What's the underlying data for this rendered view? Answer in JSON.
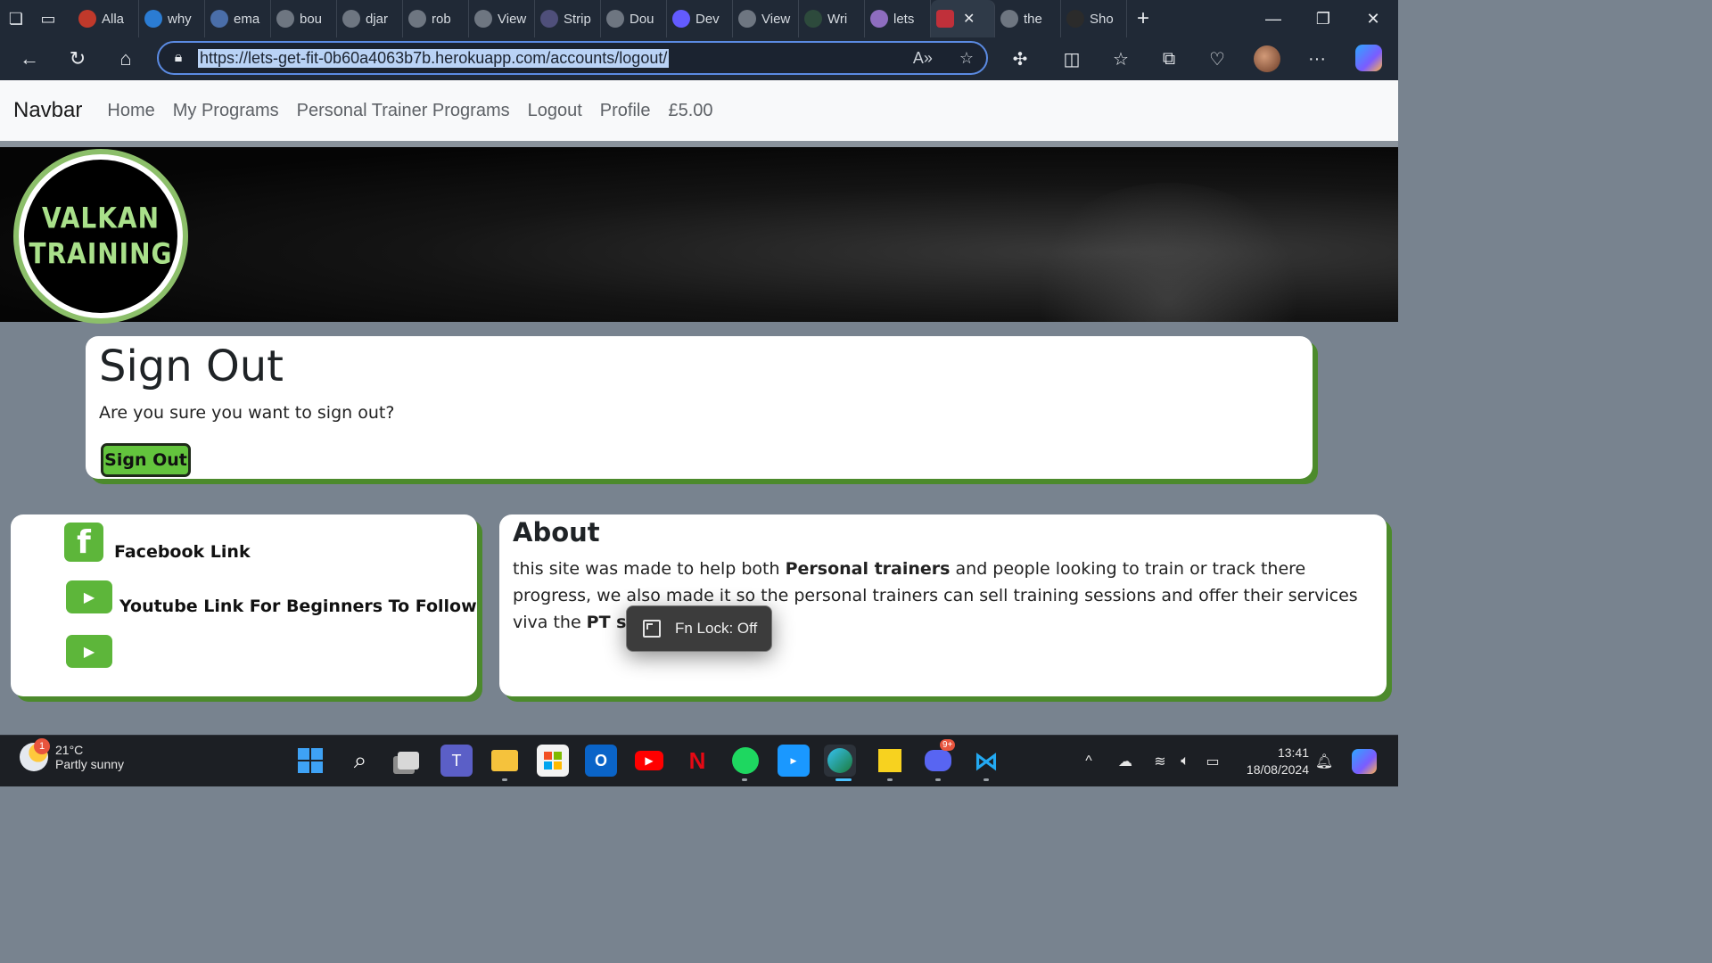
{
  "browser": {
    "tabs": [
      {
        "label": "Alla",
        "icon": "opera-icon",
        "color": "#c0392b"
      },
      {
        "label": "why",
        "icon": "bing-icon",
        "color": "#2b7cd3"
      },
      {
        "label": "ema",
        "icon": "search-icon",
        "color": "#4a6ea9"
      },
      {
        "label": "bou",
        "icon": "github-icon",
        "color": "#6e7681"
      },
      {
        "label": "djar",
        "icon": "github-icon",
        "color": "#6e7681"
      },
      {
        "label": "rob",
        "icon": "google-icon",
        "color": "#6e7681"
      },
      {
        "label": "View",
        "icon": "github-icon",
        "color": "#6e7681"
      },
      {
        "label": "Strip",
        "icon": "stripe-icon",
        "color": "#4f4f7a"
      },
      {
        "label": "Dou",
        "icon": "loading-icon",
        "color": "#6e7681"
      },
      {
        "label": "Dev",
        "icon": "stripe-icon",
        "color": "#635bff"
      },
      {
        "label": "View",
        "icon": "github-icon",
        "color": "#6e7681"
      },
      {
        "label": "Wri",
        "icon": "django-icon",
        "color": "#2d4a3c"
      },
      {
        "label": "lets",
        "icon": "heroku-icon",
        "color": "#8e6dbf"
      }
    ],
    "active_tab_close": "✕",
    "tabs_after": [
      {
        "label": "the",
        "icon": "github-icon",
        "color": "#6e7681"
      },
      {
        "label": "Sho",
        "icon": "nu-icon",
        "color": "#2b2b2b"
      }
    ],
    "new_tab": "+",
    "url": "https://lets-get-fit-0b60a4063b7b.herokuapp.com/accounts/logout/"
  },
  "site": {
    "brand": "Navbar",
    "nav_links": [
      "Home",
      "My Programs",
      "Personal Trainer Programs",
      "Logout",
      "Profile",
      "£5.00"
    ],
    "logo_line1": "VALKAN",
    "logo_line2": "TRAINING",
    "signout": {
      "title": "Sign Out",
      "text": "Are you sure you want to sign out?",
      "button": "Sign Out"
    },
    "social": {
      "facebook_label": "Facebook Link",
      "youtube_label": "Youtube Link For Beginners To Follow"
    },
    "about": {
      "title": "About",
      "text_1": "this site was made to help both ",
      "bold_1": "Personal trainers",
      "text_2": " and people looking to train or track there progress, we also made it so the personal trainers can sell training sessions and offer their services viva the ",
      "bold_2": "PT sessions tab",
      "text_3": "."
    },
    "accent_color": "#5db63a"
  },
  "toast": {
    "text": "Fn Lock: Off"
  },
  "taskbar": {
    "weather_temp": "21°C",
    "weather_desc": "Partly sunny",
    "weather_badge": "1",
    "time": "13:41",
    "date": "18/08/2024",
    "discord_badge": "9+"
  }
}
